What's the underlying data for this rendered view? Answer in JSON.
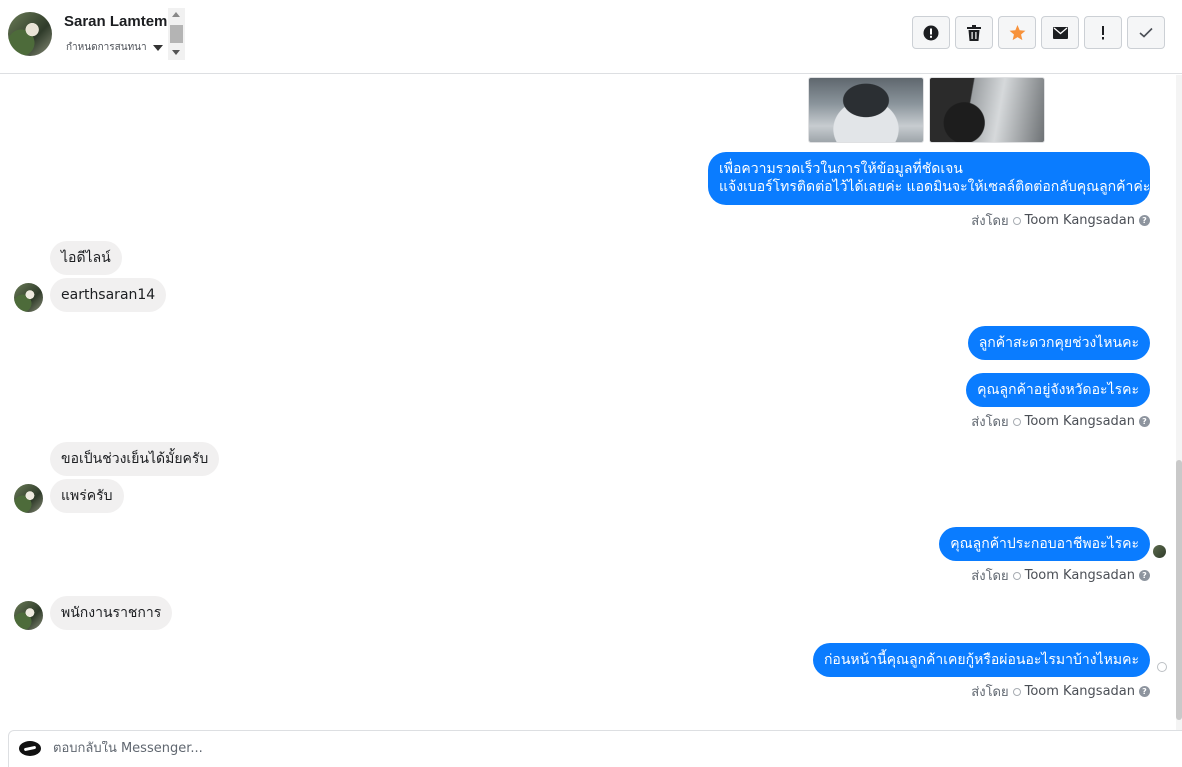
{
  "header": {
    "contact_name": "Saran Lamtem",
    "conversation_select": "กำหนดการสนทนา",
    "toolbar": [
      {
        "name": "mark-spam-button",
        "icon": "alert-circle-icon"
      },
      {
        "name": "delete-button",
        "icon": "trash-icon"
      },
      {
        "name": "star-button",
        "icon": "star-icon",
        "color": "#f7923b"
      },
      {
        "name": "mark-unread-button",
        "icon": "envelope-icon"
      },
      {
        "name": "follow-up-button",
        "icon": "exclamation-icon"
      },
      {
        "name": "mark-done-button",
        "icon": "check-icon"
      }
    ]
  },
  "messages": {
    "m1_line1": "เพื่อความรวดเร็วในการให้ข้อมูลที่ชัดเจน",
    "m1_line2": "แจ้งเบอร์โทรติดต่อไว้ได้เลยค่ะ แอดมินจะให้เซลล์ติดต่อกลับคุณลูกค้าค่ะ",
    "in1": "ไอดีไลน์",
    "in2": "earthsaran14",
    "out2": "ลูกค้าสะดวกคุยช่วงไหนคะ",
    "out3": "คุณลูกค้าอยู่จังหวัดอะไรคะ",
    "in3": "ขอเป็นช่วงเย็นได้มั้ยครับ",
    "in4": "แพร่ครับ",
    "out4": "คุณลูกค้าประกอบอาชีพอะไรคะ",
    "in5": "พนักงานราชการ",
    "out5": "ก่อนหน้านี้คุณลูกค้าเคยกู้หรือผ่อนอะไรมาบ้างไหมคะ"
  },
  "sent_by": {
    "label": "ส่งโดย",
    "agent": "Toom Kangsadan"
  },
  "composer": {
    "placeholder": "ตอบกลับใน Messenger..."
  },
  "colors": {
    "outgoing_bubble": "#0a7cff",
    "incoming_bubble": "#f1f0f0"
  }
}
